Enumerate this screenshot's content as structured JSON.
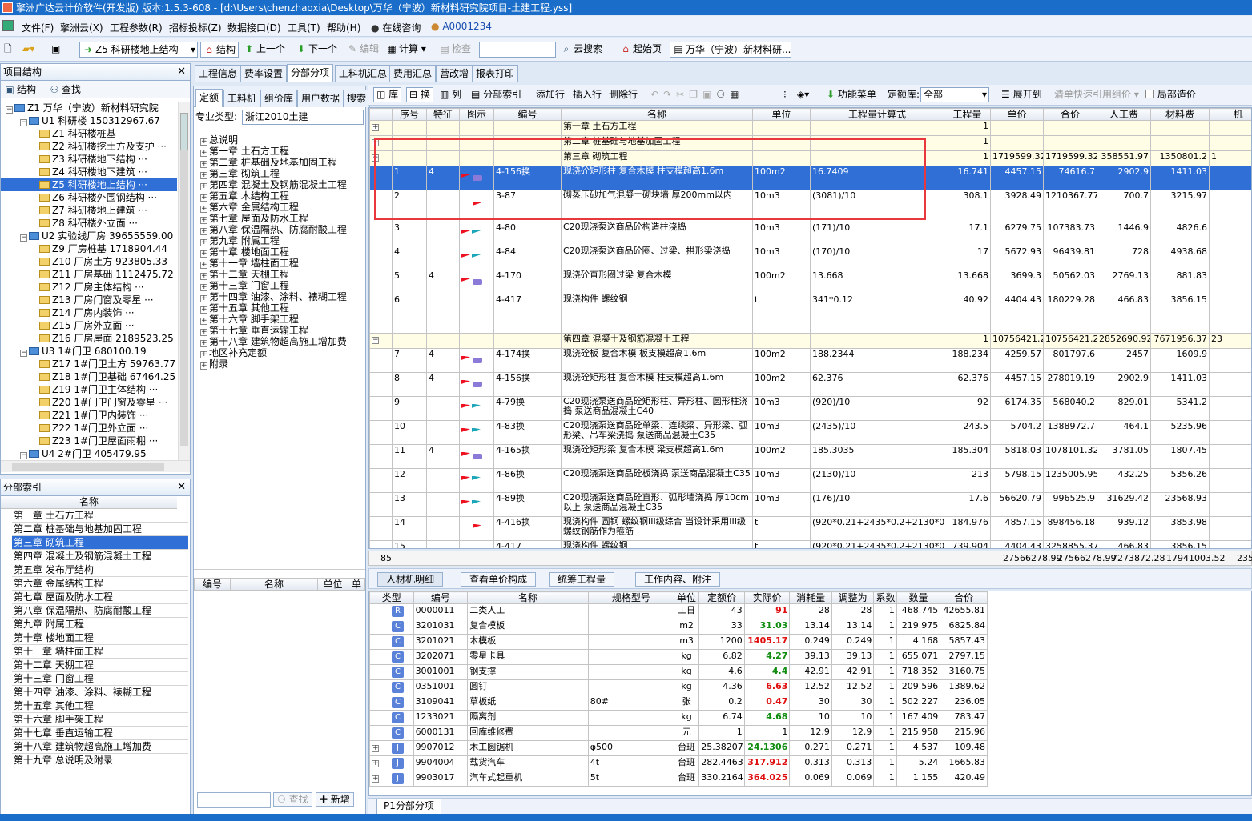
{
  "title": "擎洲广达云计价软件(开发版) 版本:1.5.3-608 - [d:\\Users\\chenzhaoxia\\Desktop\\万华（宁波）新材料研究院项目-土建工程.yss]",
  "menu": [
    "文件(F)",
    "擎洲云(X)",
    "工程参数(R)",
    "招标投标(Z)",
    "数据接口(D)",
    "工具(T)",
    "帮助(H)"
  ],
  "online": "在线咨询",
  "user": "A0001234",
  "toolbar": {
    "unit_select": "Z5  科研楼地上结构",
    "structure": "结构",
    "up": "上一个",
    "down": "下一个",
    "edit": "编辑",
    "calc": "计算",
    "check": "检查",
    "cloud_search": "云搜索",
    "start": "起始页",
    "project": "万华（宁波）新材料研..."
  },
  "left_panel": {
    "title": "项目结构",
    "struct_btn": "结构",
    "find_btn": "查找",
    "tree": [
      {
        "code": "Z1",
        "name": "万华（宁波）新材料研究院",
        "amount": "",
        "level": 0
      },
      {
        "code": "U1",
        "name": "科研楼",
        "amount": "150312967.67",
        "level": 1
      },
      {
        "code": "Z1",
        "name": "科研楼桩基",
        "amount": "",
        "level": 2
      },
      {
        "code": "Z2",
        "name": "科研楼挖土方及支护",
        "amount": "···",
        "level": 2
      },
      {
        "code": "Z3",
        "name": "科研楼地下结构",
        "amount": "···",
        "level": 2
      },
      {
        "code": "Z4",
        "name": "科研楼地下建筑",
        "amount": "···",
        "level": 2
      },
      {
        "code": "Z5",
        "name": "科研楼地上结构",
        "amount": "···",
        "level": 2,
        "selected": true
      },
      {
        "code": "Z6",
        "name": "科研楼外围钢结构",
        "amount": "···",
        "level": 2
      },
      {
        "code": "Z7",
        "name": "科研楼地上建筑",
        "amount": "···",
        "level": 2
      },
      {
        "code": "Z8",
        "name": "科研楼外立面",
        "amount": "···",
        "level": 2
      },
      {
        "code": "U2",
        "name": "实验线厂房",
        "amount": "39655559.00",
        "level": 1
      },
      {
        "code": "Z9",
        "name": "厂房桩基",
        "amount": "1718904.44",
        "level": 2
      },
      {
        "code": "Z10",
        "name": "厂房土方",
        "amount": "923805.33",
        "level": 2
      },
      {
        "code": "Z11",
        "name": "厂房基础",
        "amount": "1112475.72",
        "level": 2
      },
      {
        "code": "Z12",
        "name": "厂房主体结构",
        "amount": "···",
        "level": 2
      },
      {
        "code": "Z13",
        "name": "厂房门窗及零星",
        "amount": "···",
        "level": 2
      },
      {
        "code": "Z14",
        "name": "厂房内装饰",
        "amount": "···",
        "level": 2
      },
      {
        "code": "Z15",
        "name": "厂房外立面",
        "amount": "···",
        "level": 2
      },
      {
        "code": "Z16",
        "name": "厂房屋面",
        "amount": "2189523.25",
        "level": 2
      },
      {
        "code": "U3",
        "name": "1#门卫",
        "amount": "680100.19",
        "level": 1
      },
      {
        "code": "Z17",
        "name": "1#门卫土方",
        "amount": "59763.77",
        "level": 2
      },
      {
        "code": "Z18",
        "name": "1#门卫基础",
        "amount": "67464.25",
        "level": 2
      },
      {
        "code": "Z19",
        "name": "1#门卫主体结构",
        "amount": "···",
        "level": 2
      },
      {
        "code": "Z20",
        "name": "1#门卫门窗及零星",
        "amount": "···",
        "level": 2
      },
      {
        "code": "Z21",
        "name": "1#门卫内装饰",
        "amount": "···",
        "level": 2
      },
      {
        "code": "Z22",
        "name": "1#门卫外立面",
        "amount": "···",
        "level": 2
      },
      {
        "code": "Z23",
        "name": "1#门卫屋面雨棚",
        "amount": "···",
        "level": 2
      },
      {
        "code": "U4",
        "name": "2#门卫",
        "amount": "405479.95",
        "level": 1
      }
    ]
  },
  "index_panel": {
    "title": "分部索引",
    "col": "名称",
    "items": [
      "第一章 土石方工程",
      "第二章 桩基础与地基加固工程",
      "第三章 砌筑工程",
      "第四章 混凝土及钢筋混凝土工程",
      "第五章 发布厅结构",
      "第六章 金属结构工程",
      "第七章 屋面及防水工程",
      "第八章 保温隔热、防腐耐酸工程",
      "第九章 附属工程",
      "第十章 楼地面工程",
      "第十一章 墙柱面工程",
      "第十二章 天棚工程",
      "第十三章 门窗工程",
      "第十四章 油漆、涂料、裱糊工程",
      "第十五章 其他工程",
      "第十六章 脚手架工程",
      "第十七章 垂直运输工程",
      "第十八章 建筑物超高施工增加费",
      "第十九章 总说明及附录"
    ],
    "selected": 2
  },
  "mid_panel": {
    "tabs": [
      "定额",
      "工料机",
      "组价库",
      "用户数据",
      "搜索"
    ],
    "type_label": "专业类型:",
    "type_value": "浙江2010土建",
    "chapters": [
      "总说明",
      "第一章 土石方工程",
      "第二章 桩基础及地基加固工程",
      "第三章 砌筑工程",
      "第四章 混凝土及钢筋混凝土工程",
      "第五章 木结构工程",
      "第六章 金属结构工程",
      "第七章 屋面及防水工程",
      "第八章 保温隔热、防腐耐酸工程",
      "第九章 附属工程",
      "第十章 楼地面工程",
      "第十一章 墙柱面工程",
      "第十二章 天棚工程",
      "第十三章 门窗工程",
      "第十四章 油漆、涂料、裱糊工程",
      "第十五章 其他工程",
      "第十六章 脚手架工程",
      "第十七章 垂直运输工程",
      "第十八章 建筑物超高施工增加费",
      "地区补充定额",
      "附录"
    ],
    "cols": [
      "编号",
      "名称",
      "单位",
      "单"
    ],
    "find": "查找",
    "add": "新增"
  },
  "main_tabs": [
    "工程信息",
    "费率设置",
    "分部分项",
    "工料机汇总",
    "费用汇总",
    "营改增",
    "报表打印"
  ],
  "sub_toolbar": {
    "lib": "库",
    "switch": "换",
    "col": "列",
    "index": "分部索引",
    "add_row": "添加行",
    "insert_row": "插入行",
    "delete_row": "删除行",
    "func_menu": "功能菜单",
    "lib_label": "定额库:",
    "lib_value": "全部",
    "expand": "展开到",
    "quick_ref": "清单快速引用组价",
    "partial": "局部造价"
  },
  "grid": {
    "cols": [
      "序号",
      "特征",
      "图示",
      "编号",
      "名称",
      "单位",
      "工程量计算式",
      "工程量",
      "单价",
      "合价",
      "人工费",
      "材料费",
      "机"
    ],
    "rows": [
      {
        "kind": "chap",
        "name": "第一章 土石方工程",
        "qty": "1"
      },
      {
        "kind": "chap",
        "name": "第二章 桩基础与地基加固工程",
        "qty": "1"
      },
      {
        "kind": "chap",
        "name": "第三章 砌筑工程",
        "qty": "1",
        "price": "1719599.32",
        "total": "1719599.32",
        "labor": "358551.97",
        "mat": "1350801.2",
        "mach": "1"
      },
      {
        "kind": "item",
        "sel": true,
        "no": "1",
        "feat": "4",
        "icon": "both",
        "code": "4-156换",
        "name": "现浇砼矩形柱 复合木模 柱支模超高1.6m",
        "unit": "100m2",
        "formula": "16.7409",
        "qty": "16.741",
        "price": "4457.15",
        "total": "74616.7",
        "labor": "2902.9",
        "mat": "1411.03"
      },
      {
        "kind": "item",
        "h": 40,
        "no": "2",
        "feat": "",
        "icon": "flag",
        "code": "3-87",
        "name": "砌蒸压砂加气混凝土砌块墙 厚200mm以内",
        "unit": "10m3",
        "formula": "(3081)/10",
        "qty": "308.1",
        "price": "3928.49",
        "total": "1210367.77",
        "labor": "700.7",
        "mat": "3215.97"
      },
      {
        "kind": "item",
        "no": "3",
        "feat": "",
        "icon": "flag2",
        "code": "4-80",
        "name": "C20现浇泵送商品砼构造柱浇捣",
        "unit": "10m3",
        "formula": "(171)/10",
        "qty": "17.1",
        "price": "6279.75",
        "total": "107383.73",
        "labor": "1446.9",
        "mat": "4826.6"
      },
      {
        "kind": "item",
        "no": "4",
        "feat": "",
        "icon": "flag2",
        "code": "4-84",
        "name": "C20现浇泵送商品砼圈、过梁、拱形梁浇捣",
        "unit": "10m3",
        "formula": "(170)/10",
        "qty": "17",
        "price": "5672.93",
        "total": "96439.81",
        "labor": "728",
        "mat": "4938.68"
      },
      {
        "kind": "item",
        "no": "5",
        "feat": "4",
        "icon": "both",
        "code": "4-170",
        "name": "现浇砼直形圈过梁 复合木模",
        "unit": "100m2",
        "formula": "13.668",
        "qty": "13.668",
        "price": "3699.3",
        "total": "50562.03",
        "labor": "2769.13",
        "mat": "881.83"
      },
      {
        "kind": "item",
        "no": "6",
        "feat": "",
        "icon": "",
        "code": "4-417",
        "name": "现浇构件 螺纹钢",
        "unit": "t",
        "formula": "341*0.12",
        "qty": "40.92",
        "price": "4404.43",
        "total": "180229.28",
        "labor": "466.83",
        "mat": "3856.15"
      },
      {
        "kind": "blank"
      },
      {
        "kind": "chap",
        "name": "第四章 混凝土及钢筋混凝土工程",
        "qty": "1",
        "price": "10756421.27",
        "total": "10756421.27",
        "labor": "2852690.92",
        "mat": "7671956.37",
        "mach": "23"
      },
      {
        "kind": "item",
        "no": "7",
        "feat": "4",
        "icon": "both",
        "code": "4-174换",
        "name": "现浇砼板 复合木模 板支模超高1.6m",
        "unit": "100m2",
        "formula": "188.2344",
        "qty": "188.234",
        "price": "4259.57",
        "total": "801797.6",
        "labor": "2457",
        "mat": "1609.9"
      },
      {
        "kind": "item",
        "no": "8",
        "feat": "4",
        "icon": "both",
        "code": "4-156换",
        "name": "现浇砼矩形柱 复合木模 柱支模超高1.6m",
        "unit": "100m2",
        "formula": "62.376",
        "qty": "62.376",
        "price": "4457.15",
        "total": "278019.19",
        "labor": "2902.9",
        "mat": "1411.03"
      },
      {
        "kind": "item",
        "no": "9",
        "feat": "",
        "icon": "flag2",
        "code": "4-79换",
        "name": "C20现浇泵送商品砼矩形柱、异形柱、圆形柱浇捣 泵送商品混凝土C40",
        "unit": "10m3",
        "formula": "(920)/10",
        "qty": "92",
        "price": "6174.35",
        "total": "568040.2",
        "labor": "829.01",
        "mat": "5341.2"
      },
      {
        "kind": "item",
        "no": "10",
        "feat": "",
        "icon": "flag2",
        "code": "4-83换",
        "name": "C20现浇泵送商品砼单梁、连续梁、异形梁、弧形梁、吊车梁浇捣 泵送商品混凝土C35",
        "unit": "10m3",
        "formula": "(2435)/10",
        "qty": "243.5",
        "price": "5704.2",
        "total": "1388972.7",
        "labor": "464.1",
        "mat": "5235.96"
      },
      {
        "kind": "item",
        "no": "11",
        "feat": "4",
        "icon": "both",
        "code": "4-165换",
        "name": "现浇砼矩形梁 复合木模 梁支模超高1.6m",
        "unit": "100m2",
        "formula": "185.3035",
        "qty": "185.304",
        "price": "5818.03",
        "total": "1078101.32",
        "labor": "3781.05",
        "mat": "1807.45"
      },
      {
        "kind": "item",
        "no": "12",
        "feat": "",
        "icon": "flag2",
        "code": "4-86换",
        "name": "C20现浇泵送商品砼板浇捣 泵送商品混凝土C35",
        "unit": "10m3",
        "formula": "(2130)/10",
        "qty": "213",
        "price": "5798.15",
        "total": "1235005.95",
        "labor": "432.25",
        "mat": "5356.26"
      },
      {
        "kind": "item",
        "no": "13",
        "feat": "",
        "icon": "flag2",
        "code": "4-89换",
        "name": "C20现浇泵送商品砼直形、弧形墙浇捣 厚10cm以上 泵送商品混凝土C35",
        "unit": "10m3",
        "formula": "(176)/10",
        "qty": "17.6",
        "price": "56620.79",
        "total": "996525.9",
        "labor": "31629.42",
        "mat": "23568.93"
      },
      {
        "kind": "item",
        "no": "14",
        "feat": "",
        "icon": "flag",
        "code": "4-416换",
        "name": "现浇构件 圆钢 螺纹钢III级综合 当设计采用III级螺纹钢筋作为箍筋",
        "unit": "t",
        "formula": "(920*0.21+2435*0.2+2130*0.1+",
        "qty": "184.976",
        "price": "4857.15",
        "total": "898456.18",
        "labor": "939.12",
        "mat": "3853.98"
      },
      {
        "kind": "item",
        "h": 19,
        "no": "15",
        "feat": "",
        "icon": "",
        "code": "4-417",
        "name": "现浇构件 螺纹钢",
        "unit": "t",
        "formula": "(920*0.21+2435*0.2+2130*0.1+",
        "qty": "739.904",
        "price": "4404.43",
        "total": "3258855.37",
        "labor": "466.83",
        "mat": "3856.15"
      }
    ],
    "footer": {
      "count": "85",
      "total": "27566278.99",
      "total2": "27566278.99",
      "labor": "7273872.28",
      "mat": "17941003.52",
      "mach": "235"
    }
  },
  "bottom_tabs": [
    "人材机明细",
    "查看单价构成",
    "统筹工程量",
    "工作内容、附注"
  ],
  "res": {
    "cols": [
      "类型",
      "编号",
      "名称",
      "规格型号",
      "单位",
      "定额价",
      "实际价",
      "消耗量",
      "调整为",
      "系数",
      "数量",
      "合价"
    ],
    "rows": [
      {
        "t": "R",
        "code": "0000011",
        "name": "二类人工",
        "spec": "",
        "unit": "工日",
        "base": "43",
        "real": "91",
        "rc": "red",
        "cons": "28",
        "adj": "28",
        "k": "1",
        "qty": "468.745",
        "sum": "42655.81"
      },
      {
        "t": "C",
        "code": "3201031",
        "name": "复合模板",
        "spec": "",
        "unit": "m2",
        "base": "33",
        "real": "31.03",
        "rc": "grn",
        "cons": "13.14",
        "adj": "13.14",
        "k": "1",
        "qty": "219.975",
        "sum": "6825.84"
      },
      {
        "t": "C",
        "code": "3201021",
        "name": "木模板",
        "spec": "",
        "unit": "m3",
        "base": "1200",
        "real": "1405.17",
        "rc": "red",
        "cons": "0.249",
        "adj": "0.249",
        "k": "1",
        "qty": "4.168",
        "sum": "5857.43"
      },
      {
        "t": "C",
        "code": "3202071",
        "name": "零星卡具",
        "spec": "",
        "unit": "kg",
        "base": "6.82",
        "real": "4.27",
        "rc": "grn",
        "cons": "39.13",
        "adj": "39.13",
        "k": "1",
        "qty": "655.071",
        "sum": "2797.15"
      },
      {
        "t": "C",
        "code": "3001001",
        "name": "钢支撑",
        "spec": "",
        "unit": "kg",
        "base": "4.6",
        "real": "4.4",
        "rc": "grn",
        "cons": "42.91",
        "adj": "42.91",
        "k": "1",
        "qty": "718.352",
        "sum": "3160.75"
      },
      {
        "t": "C",
        "code": "0351001",
        "name": "圆钉",
        "spec": "",
        "unit": "kg",
        "base": "4.36",
        "real": "6.63",
        "rc": "red",
        "cons": "12.52",
        "adj": "12.52",
        "k": "1",
        "qty": "209.596",
        "sum": "1389.62"
      },
      {
        "t": "C",
        "code": "3109041",
        "name": "草板纸",
        "spec": "80#",
        "unit": "张",
        "base": "0.2",
        "real": "0.47",
        "rc": "red",
        "cons": "30",
        "adj": "30",
        "k": "1",
        "qty": "502.227",
        "sum": "236.05"
      },
      {
        "t": "C",
        "code": "1233021",
        "name": "隔离剂",
        "spec": "",
        "unit": "kg",
        "base": "6.74",
        "real": "4.68",
        "rc": "grn",
        "cons": "10",
        "adj": "10",
        "k": "1",
        "qty": "167.409",
        "sum": "783.47"
      },
      {
        "t": "C",
        "code": "6000131",
        "name": "回库维修费",
        "spec": "",
        "unit": "元",
        "base": "1",
        "real": "1",
        "rc": "",
        "cons": "12.9",
        "adj": "12.9",
        "k": "1",
        "qty": "215.958",
        "sum": "215.96"
      },
      {
        "t": "J",
        "code": "9907012",
        "name": "木工圆锯机",
        "spec": "φ500",
        "unit": "台班",
        "base": "25.38207",
        "real": "24.1306",
        "rc": "grn",
        "cons": "0.271",
        "adj": "0.271",
        "k": "1",
        "qty": "4.537",
        "sum": "109.48",
        "exp": true
      },
      {
        "t": "J",
        "code": "9904004",
        "name": "载货汽车",
        "spec": "4t",
        "unit": "台班",
        "base": "282.4463",
        "real": "317.912",
        "rc": "red",
        "cons": "0.313",
        "adj": "0.313",
        "k": "1",
        "qty": "5.24",
        "sum": "1665.83",
        "exp": true
      },
      {
        "t": "J",
        "code": "9903017",
        "name": "汽车式起重机",
        "spec": "5t",
        "unit": "台班",
        "base": "330.2164",
        "real": "364.025",
        "rc": "red",
        "cons": "0.069",
        "adj": "0.069",
        "k": "1",
        "qty": "1.155",
        "sum": "420.49",
        "exp": true
      }
    ]
  },
  "sheet_tab": "P1分部分项",
  "colors": {
    "accent": "#1a6dc8",
    "selection": "#2f6fd6",
    "highlight_box": "#e8383d"
  }
}
